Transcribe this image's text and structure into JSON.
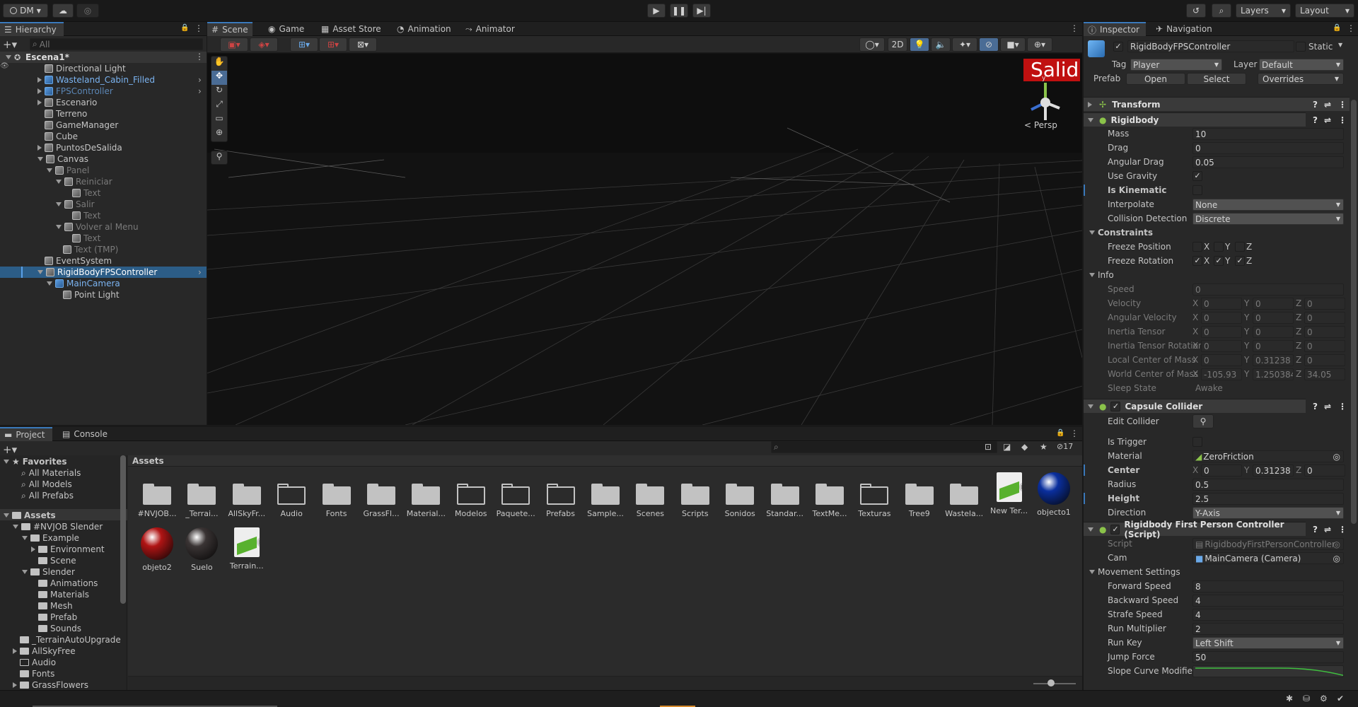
{
  "topbar": {
    "account": "DM",
    "layers": "Layers",
    "layout": "Layout"
  },
  "hierarchy": {
    "tab": "Hierarchy",
    "search_placeholder": "All",
    "scene": "Escena1*",
    "items": [
      {
        "label": "Directional Light",
        "depth": 1,
        "kind": "go",
        "arrow": "",
        "color": "#c4c4c4"
      },
      {
        "label": "Wasteland_Cabin_Filled",
        "depth": 1,
        "kind": "prefab",
        "arrow": "right",
        "color": "#7bb4f2",
        "chev": true
      },
      {
        "label": "FPSController",
        "depth": 1,
        "kind": "prefab",
        "arrow": "right",
        "color": "#5b86b5",
        "chev": true
      },
      {
        "label": "Escenario",
        "depth": 1,
        "kind": "go",
        "arrow": "right",
        "color": "#c4c4c4"
      },
      {
        "label": "Terreno",
        "depth": 1,
        "kind": "go",
        "arrow": "",
        "color": "#c4c4c4"
      },
      {
        "label": "GameManager",
        "depth": 1,
        "kind": "go",
        "arrow": "",
        "color": "#c4c4c4"
      },
      {
        "label": "Cube",
        "depth": 1,
        "kind": "go",
        "arrow": "",
        "color": "#c4c4c4"
      },
      {
        "label": "PuntosDeSalida",
        "depth": 1,
        "kind": "go",
        "arrow": "right",
        "color": "#c4c4c4"
      },
      {
        "label": "Canvas",
        "depth": 1,
        "kind": "go",
        "arrow": "down",
        "color": "#c4c4c4"
      },
      {
        "label": "Panel",
        "depth": 2,
        "kind": "go",
        "arrow": "down",
        "color": "#7a7a7a"
      },
      {
        "label": "Reiniciar",
        "depth": 3,
        "kind": "go",
        "arrow": "down",
        "color": "#7a7a7a"
      },
      {
        "label": "Text",
        "depth": 4,
        "kind": "go",
        "arrow": "",
        "color": "#7a7a7a"
      },
      {
        "label": "Salir",
        "depth": 3,
        "kind": "go",
        "arrow": "down",
        "color": "#7a7a7a"
      },
      {
        "label": "Text",
        "depth": 4,
        "kind": "go",
        "arrow": "",
        "color": "#7a7a7a"
      },
      {
        "label": "Volver al Menu",
        "depth": 3,
        "kind": "go",
        "arrow": "down",
        "color": "#7a7a7a"
      },
      {
        "label": "Text",
        "depth": 4,
        "kind": "go",
        "arrow": "",
        "color": "#7a7a7a"
      },
      {
        "label": "Text (TMP)",
        "depth": 3,
        "kind": "go",
        "arrow": "",
        "color": "#7a7a7a"
      },
      {
        "label": "EventSystem",
        "depth": 1,
        "kind": "go",
        "arrow": "",
        "color": "#c4c4c4"
      },
      {
        "label": "RigidBodyFPSController",
        "depth": 1,
        "kind": "go",
        "arrow": "down",
        "color": "#ffffff",
        "selected": true,
        "chev": true
      },
      {
        "label": "MainCamera",
        "depth": 2,
        "kind": "prefab",
        "arrow": "down",
        "color": "#7bb4f2"
      },
      {
        "label": "Point Light",
        "depth": 3,
        "kind": "go",
        "arrow": "",
        "color": "#c4c4c4"
      }
    ]
  },
  "scene": {
    "tabs": [
      "Scene",
      "Game",
      "Asset Store",
      "Animation",
      "Animator"
    ],
    "btn_2d": "2D",
    "persp": "< Persp",
    "overlay_text": "Salid",
    "gizmo_y": "y"
  },
  "project": {
    "tabs": [
      "Project",
      "Console"
    ],
    "count": "17",
    "favorites": {
      "label": "Favorites",
      "items": [
        "All Materials",
        "All Models",
        "All Prefabs"
      ]
    },
    "tree": [
      {
        "label": "Assets",
        "depth": 0,
        "arrow": "down",
        "bold": true
      },
      {
        "label": "#NVJOB Slender",
        "depth": 1,
        "arrow": "down"
      },
      {
        "label": "Example",
        "depth": 2,
        "arrow": "down"
      },
      {
        "label": "Environment",
        "depth": 3,
        "arrow": "right"
      },
      {
        "label": "Scene",
        "depth": 3,
        "arrow": ""
      },
      {
        "label": "Slender",
        "depth": 2,
        "arrow": "down"
      },
      {
        "label": "Animations",
        "depth": 3,
        "arrow": ""
      },
      {
        "label": "Materials",
        "depth": 3,
        "arrow": ""
      },
      {
        "label": "Mesh",
        "depth": 3,
        "arrow": ""
      },
      {
        "label": "Prefab",
        "depth": 3,
        "arrow": ""
      },
      {
        "label": "Sounds",
        "depth": 3,
        "arrow": ""
      },
      {
        "label": "_TerrainAutoUpgrade",
        "depth": 1,
        "arrow": ""
      },
      {
        "label": "AllSkyFree",
        "depth": 1,
        "arrow": "right"
      },
      {
        "label": "Audio",
        "depth": 1,
        "arrow": "",
        "empty": true
      },
      {
        "label": "Fonts",
        "depth": 1,
        "arrow": ""
      },
      {
        "label": "GrassFlowers",
        "depth": 1,
        "arrow": "right"
      }
    ],
    "breadcrumb": "Assets",
    "assets": [
      {
        "label": "#NVJOB...",
        "kind": "folder"
      },
      {
        "label": "_Terrai...",
        "kind": "folder"
      },
      {
        "label": "AllSkyFr...",
        "kind": "folder"
      },
      {
        "label": "Audio",
        "kind": "folder-empty"
      },
      {
        "label": "Fonts",
        "kind": "folder"
      },
      {
        "label": "GrassFl...",
        "kind": "folder"
      },
      {
        "label": "Material...",
        "kind": "folder"
      },
      {
        "label": "Modelos",
        "kind": "folder-empty"
      },
      {
        "label": "Paquete...",
        "kind": "folder-empty"
      },
      {
        "label": "Prefabs",
        "kind": "folder-empty"
      },
      {
        "label": "Sample...",
        "kind": "folder"
      },
      {
        "label": "Scenes",
        "kind": "folder"
      },
      {
        "label": "Scripts",
        "kind": "folder"
      },
      {
        "label": "Sonidos",
        "kind": "folder"
      },
      {
        "label": "Standar...",
        "kind": "folder"
      },
      {
        "label": "TextMe...",
        "kind": "folder"
      },
      {
        "label": "Texturas",
        "kind": "folder-empty"
      },
      {
        "label": "Tree9",
        "kind": "folder"
      },
      {
        "label": "Wastela...",
        "kind": "folder"
      },
      {
        "label": "New Ter...",
        "kind": "terrain"
      },
      {
        "label": "objecto1",
        "kind": "sphere",
        "color": "#0a2f9e"
      },
      {
        "label": "objeto2",
        "kind": "sphere",
        "color": "#b01414"
      },
      {
        "label": "Suelo",
        "kind": "sphere",
        "color": "#3a3434"
      },
      {
        "label": "Terrain...",
        "kind": "terrain"
      }
    ]
  },
  "inspector": {
    "tabs": [
      "Inspector",
      "Navigation"
    ],
    "object_name": "RigidBodyFPSController",
    "static": "Static",
    "tag_label": "Tag",
    "tag": "Player",
    "layer_label": "Layer",
    "layer": "Default",
    "prefab_label": "Prefab",
    "open": "Open",
    "select": "Select",
    "overrides": "Overrides",
    "transform": "Transform",
    "rigidbody": {
      "title": "Rigidbody",
      "mass_l": "Mass",
      "mass": "10",
      "drag_l": "Drag",
      "drag": "0",
      "ang_l": "Angular Drag",
      "ang": "0.05",
      "grav_l": "Use Gravity",
      "kin_l": "Is Kinematic",
      "interp_l": "Interpolate",
      "interp": "None",
      "coll_l": "Collision Detection",
      "coll": "Discrete",
      "constraints": "Constraints",
      "fpos": "Freeze Position",
      "frot": "Freeze Rotation",
      "info": "Info",
      "speed_l": "Speed",
      "speed": "0",
      "vel_l": "Velocity",
      "vel": [
        "0",
        "0",
        "0"
      ],
      "avel_l": "Angular Velocity",
      "avel": [
        "0",
        "0",
        "0"
      ],
      "it_l": "Inertia Tensor",
      "it": [
        "0",
        "0",
        "0"
      ],
      "itr_l": "Inertia Tensor Rotation",
      "itr": [
        "0",
        "0",
        "0"
      ],
      "lcm_l": "Local Center of Mass",
      "lcm": [
        "0",
        "0.31238",
        "0"
      ],
      "wcm_l": "World Center of Mass",
      "wcm": [
        "-105.93",
        "1.250384",
        "34.05"
      ],
      "sleep_l": "Sleep State",
      "sleep": "Awake"
    },
    "capsule": {
      "title": "Capsule Collider",
      "edit_l": "Edit Collider",
      "trig_l": "Is Trigger",
      "mat_l": "Material",
      "mat": "ZeroFriction",
      "center_l": "Center",
      "center": [
        "0",
        "0.31238",
        "0"
      ],
      "radius_l": "Radius",
      "radius": "0.5",
      "height_l": "Height",
      "height": "2.5",
      "dir_l": "Direction",
      "dir": "Y-Axis"
    },
    "script": {
      "title": "Rigidbody First Person Controller (Script)",
      "script_l": "Script",
      "script": "RigidbodyFirstPersonController",
      "cam_l": "Cam",
      "cam": "MainCamera (Camera)",
      "move": "Movement Settings",
      "fwd_l": "Forward Speed",
      "fwd": "8",
      "back_l": "Backward Speed",
      "back": "4",
      "strafe_l": "Strafe Speed",
      "strafe": "4",
      "run_l": "Run Multiplier",
      "run": "2",
      "key_l": "Run Key",
      "key": "Left Shift",
      "jump_l": "Jump Force",
      "jump": "50",
      "slope_l": "Slope Curve Modifier"
    }
  }
}
